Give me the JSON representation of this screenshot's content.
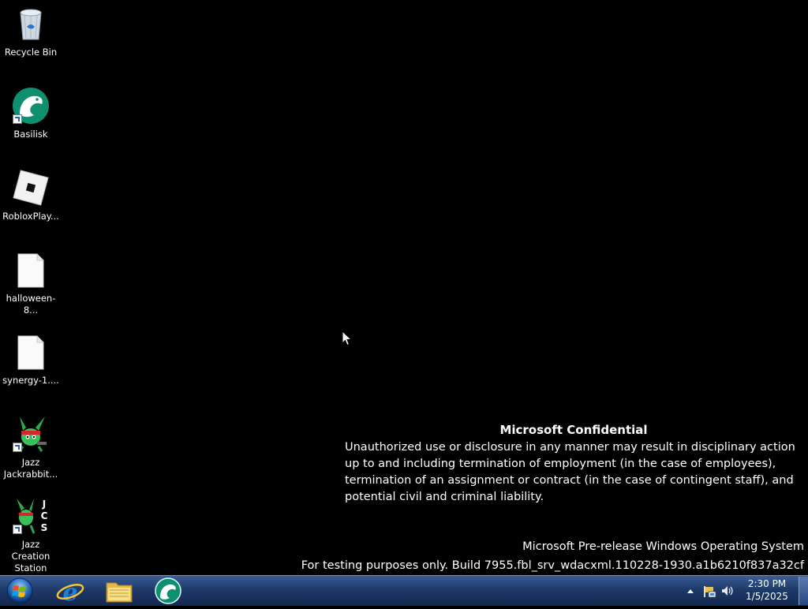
{
  "desktop": {
    "icons": [
      {
        "name": "recycle-bin",
        "label": "Recycle Bin",
        "icon": "recycle-bin-icon"
      },
      {
        "name": "basilisk",
        "label": "Basilisk",
        "icon": "basilisk-browser-icon"
      },
      {
        "name": "roblox-player",
        "label": "RobloxPlay...",
        "icon": "roblox-icon"
      },
      {
        "name": "halloween-file",
        "label": "halloween-8...",
        "icon": "blank-file-icon"
      },
      {
        "name": "synergy-file",
        "label": "synergy-1....",
        "icon": "blank-file-icon"
      },
      {
        "name": "jazz-jackrabbit",
        "label": "Jazz Jackrabbit...",
        "icon": "jazz-jackrabbit-icon"
      },
      {
        "name": "jazz-creation-station",
        "label": "Jazz Creation Station",
        "icon": "jcs-icon"
      }
    ]
  },
  "watermark": {
    "title": "Microsoft Confidential",
    "body": "Unauthorized use or disclosure in any manner may result in disciplinary action up to and including termination of employment (in the case of employees), termination of an assignment or contract (in the case of contingent staff), and potential civil and criminal liability.",
    "os_line": "Microsoft Pre-release Windows Operating System",
    "build_line": "For testing purposes only. Build 7955.fbl_srv_wdacxml.110228-1930.a1b6210f837a32cf"
  },
  "taskbar": {
    "pinned": [
      {
        "name": "internet-explorer",
        "icon": "internet-explorer-icon"
      },
      {
        "name": "windows-explorer",
        "icon": "folder-icon"
      },
      {
        "name": "basilisk",
        "icon": "basilisk-browser-icon"
      }
    ],
    "clock": {
      "time": "2:30 PM",
      "date": "1/5/2025"
    }
  },
  "colors": {
    "taskbar_top": "#3b5e93",
    "taskbar_bottom": "#13284f",
    "basilisk_green": "#0f8f6f",
    "ie_blue": "#1e7fd8"
  }
}
